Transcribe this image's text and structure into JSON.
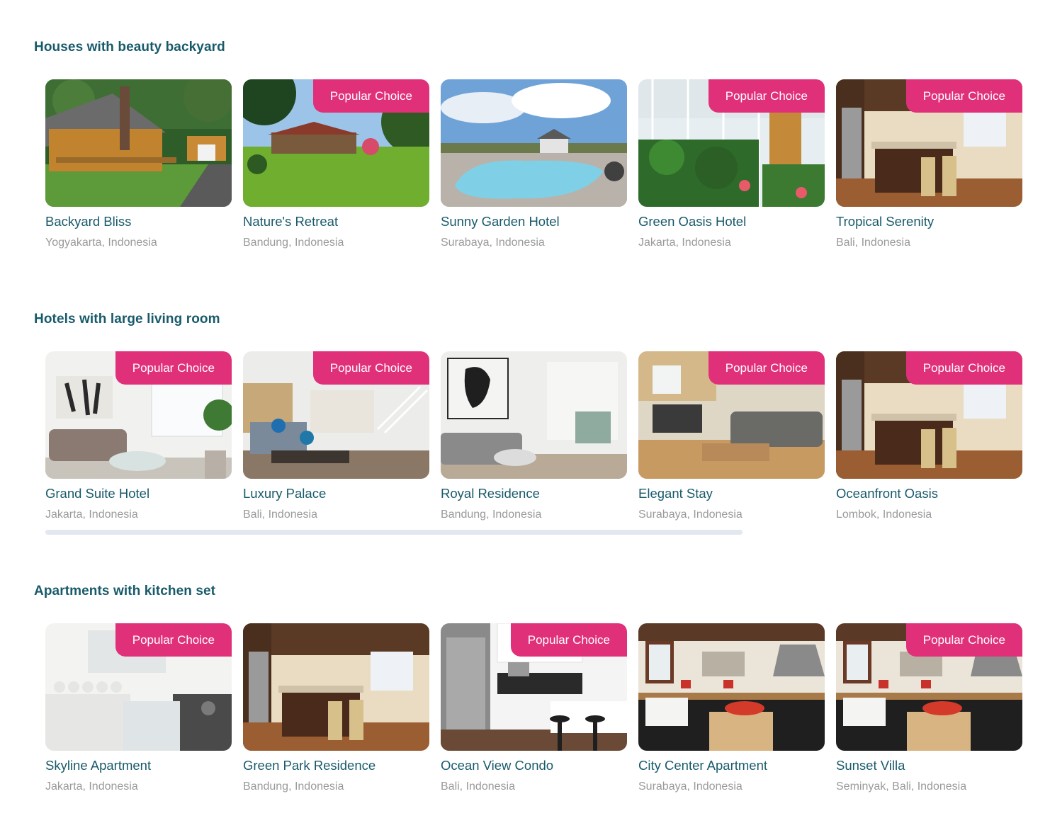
{
  "badge_label": "Popular Choice",
  "sections": [
    {
      "title": "Houses with beauty backyard",
      "cards": [
        {
          "name": "Backyard Bliss",
          "location": "Yogyakarta, Indonesia",
          "popular": false,
          "scene": "cabin"
        },
        {
          "name": "Nature's Retreat",
          "location": "Bandung, Indonesia",
          "popular": true,
          "scene": "garden"
        },
        {
          "name": "Sunny Garden Hotel",
          "location": "Surabaya, Indonesia",
          "popular": false,
          "scene": "pool"
        },
        {
          "name": "Green Oasis Hotel",
          "location": "Jakarta, Indonesia",
          "popular": true,
          "scene": "greenhouse"
        },
        {
          "name": "Tropical Serenity",
          "location": "Bali, Indonesia",
          "popular": true,
          "scene": "kitchen-wood"
        }
      ]
    },
    {
      "title": "Hotels with large living room",
      "cards": [
        {
          "name": "Grand Suite Hotel",
          "location": "Jakarta, Indonesia",
          "popular": true,
          "scene": "living-white"
        },
        {
          "name": "Luxury Palace",
          "location": "Bali, Indonesia",
          "popular": true,
          "scene": "living-blue"
        },
        {
          "name": "Royal Residence",
          "location": "Bandung, Indonesia",
          "popular": false,
          "scene": "living-gray"
        },
        {
          "name": "Elegant Stay",
          "location": "Surabaya, Indonesia",
          "popular": true,
          "scene": "living-dining"
        },
        {
          "name": "Oceanfront Oasis",
          "location": "Lombok, Indonesia",
          "popular": true,
          "scene": "kitchen-wood"
        }
      ]
    },
    {
      "title": "Apartments with kitchen set",
      "cards": [
        {
          "name": "Skyline Apartment",
          "location": "Jakarta, Indonesia",
          "popular": true,
          "scene": "kitchen-white"
        },
        {
          "name": "Green Park Residence",
          "location": "Bandung, Indonesia",
          "popular": false,
          "scene": "kitchen-wood"
        },
        {
          "name": "Ocean View Condo",
          "location": "Bali, Indonesia",
          "popular": true,
          "scene": "kitchen-modern"
        },
        {
          "name": "City Center Apartment",
          "location": "Surabaya, Indonesia",
          "popular": false,
          "scene": "kitchen-farm"
        },
        {
          "name": "Sunset Villa",
          "location": "Seminyak, Bali, Indonesia",
          "popular": true,
          "scene": "kitchen-farm"
        }
      ]
    }
  ],
  "colors": {
    "title": "#185a6b",
    "badge": "#e1307a",
    "location": "#9a9a9a",
    "scrollbar": "#e2e8f0"
  }
}
